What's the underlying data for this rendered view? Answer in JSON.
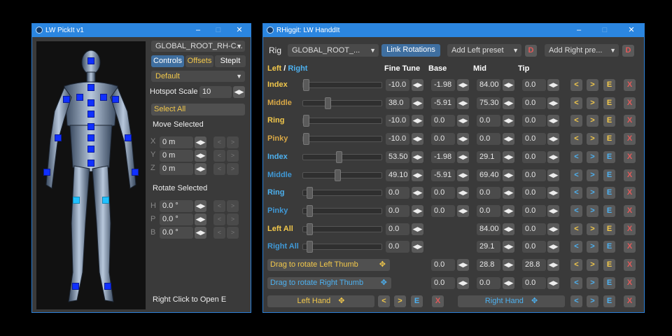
{
  "colors": {
    "accent": "#2b86e0",
    "left": "#f2c84b",
    "left_dim": "#d9a846",
    "right": "#4db1f0",
    "right_dim": "#3f98d6",
    "close_red": "#e15a5a",
    "edit_orange": "#f0a030"
  },
  "pickkit": {
    "title": "LW PickIt v1",
    "rig_select": "GLOBAL_ROOT_RH-C...",
    "tabs": [
      "Controls",
      "Offsets",
      "StepIt"
    ],
    "preset": "Default",
    "hotspot_label": "Hotspot Scale",
    "hotspot_value": "10",
    "select_all": "Select All",
    "move_label": "Move Selected",
    "move": [
      {
        "axis": "X",
        "value": "0 m"
      },
      {
        "axis": "Y",
        "value": "0 m"
      },
      {
        "axis": "Z",
        "value": "0 m"
      }
    ],
    "rotate_label": "Rotate Selected",
    "rotate": [
      {
        "axis": "H",
        "value": "0.0 °"
      },
      {
        "axis": "P",
        "value": "0.0 °"
      },
      {
        "axis": "B",
        "value": "0.0 °"
      }
    ],
    "footer": "Right Click to Open E"
  },
  "handdit": {
    "title": "RHiggit: LW HanddIt",
    "rig_label": "Rig",
    "rig_select": "GLOBAL_ROOT_...",
    "link_rotations": "Link Rotations",
    "add_left": "Add Left preset",
    "add_right": "Add Right pre...",
    "d": "D",
    "hand_left": "Left",
    "hand_sep": "/",
    "hand_right": "Right",
    "cols": [
      "Fine Tune",
      "Base",
      "Mid",
      "Tip"
    ],
    "btn_prev": "<",
    "btn_next": ">",
    "btn_e": "E",
    "btn_x": "X",
    "rows": [
      {
        "label": "Index",
        "side": "L",
        "fine": "-10.0",
        "base": "-1.98",
        "mid": "84.00",
        "tip": "0.0",
        "slider": 0
      },
      {
        "label": "Middle",
        "side": "Ld",
        "fine": "38.0",
        "base": "-5.91",
        "mid": "75.30",
        "tip": "0.0",
        "slider": 0.3
      },
      {
        "label": "Ring",
        "side": "L",
        "fine": "-10.0",
        "base": "0.0",
        "mid": "0.0",
        "tip": "0.0",
        "slider": 0
      },
      {
        "label": "Pinky",
        "side": "Ld",
        "fine": "-10.0",
        "base": "0.0",
        "mid": "0.0",
        "tip": "0.0",
        "slider": 0
      },
      {
        "label": "Index",
        "side": "R",
        "fine": "53.50",
        "base": "-1.98",
        "mid": "29.1",
        "tip": "0.0",
        "slider": 0.45
      },
      {
        "label": "Middle",
        "side": "Rd",
        "fine": "49.10",
        "base": "-5.91",
        "mid": "69.40",
        "tip": "0.0",
        "slider": 0.43
      },
      {
        "label": "Ring",
        "side": "R",
        "fine": "0.0",
        "base": "0.0",
        "mid": "0.0",
        "tip": "0.0",
        "slider": 0.05
      },
      {
        "label": "Pinky",
        "side": "Rd",
        "fine": "0.0",
        "base": "0.0",
        "mid": "0.0",
        "tip": "0.0",
        "slider": 0.05
      },
      {
        "label": "Left All",
        "side": "L",
        "fine": "0.0",
        "base": "",
        "mid": "84.00",
        "tip": "0.0",
        "slider": 0.05
      },
      {
        "label": "Right All",
        "side": "Rd",
        "fine": "0.0",
        "base": "",
        "mid": "29.1",
        "tip": "0.0",
        "slider": 0.05
      }
    ],
    "thumb_left": {
      "label": "Drag to rotate Left Thumb",
      "base": "0.0",
      "mid": "28.8",
      "tip": "28.8"
    },
    "thumb_right": {
      "label": "Drag to rotate Right Thumb",
      "base": "0.0",
      "mid": "0.0",
      "tip": "0.0"
    },
    "left_hand": "Left Hand",
    "right_hand": "Right Hand"
  }
}
